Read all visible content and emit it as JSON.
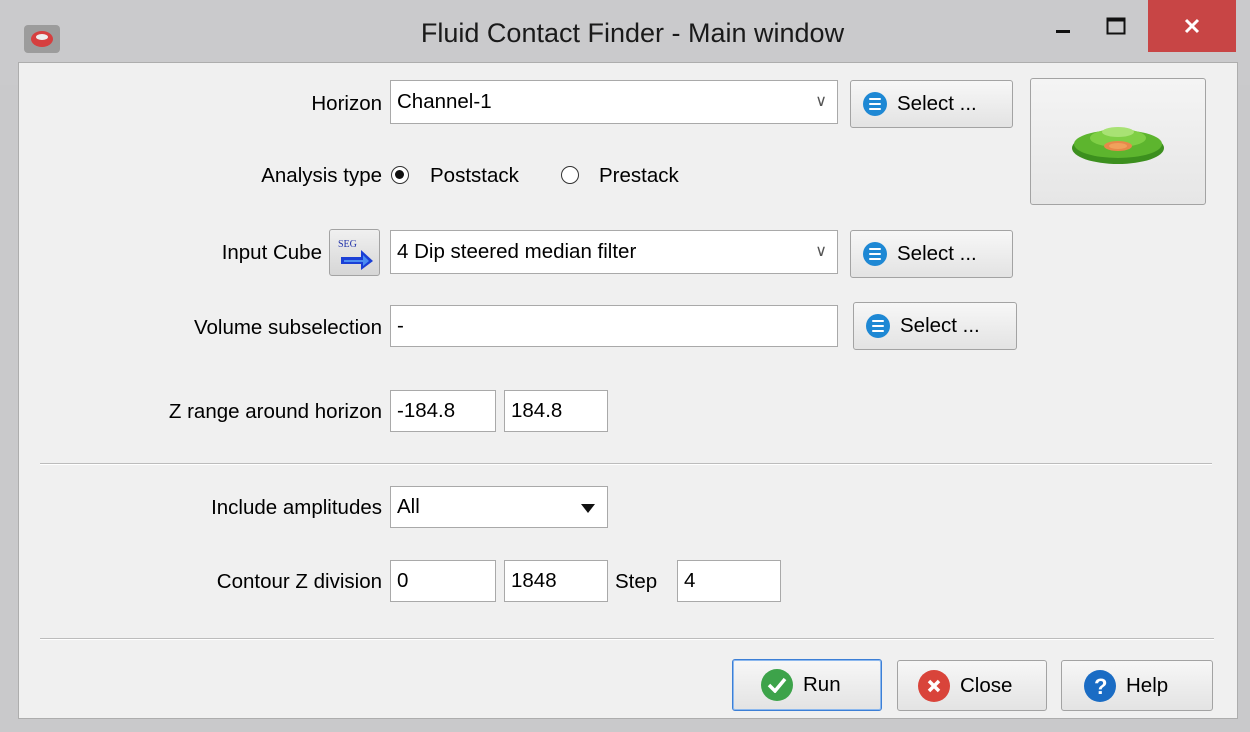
{
  "window": {
    "title": "Fluid Contact Finder - Main window"
  },
  "horizon": {
    "label": "Horizon",
    "value": "Channel-1",
    "select_label": "Select ..."
  },
  "analysis": {
    "label": "Analysis type",
    "options": [
      "Poststack",
      "Prestack"
    ],
    "selected": "Poststack"
  },
  "input_cube": {
    "label": "Input Cube",
    "value": "4 Dip steered median filter",
    "select_label": "Select ...",
    "icon_text": "SEG"
  },
  "volume": {
    "label": "Volume subselection",
    "value": "-",
    "select_label": "Select ..."
  },
  "zrange": {
    "label": "Z range around horizon",
    "start": "-184.8",
    "stop": "184.8"
  },
  "amplitudes": {
    "label": "Include amplitudes",
    "value": "All"
  },
  "contour": {
    "label": "Contour Z division",
    "start": "0",
    "stop": "1848",
    "step_label": "Step",
    "step": "4"
  },
  "buttons": {
    "run": "Run",
    "close": "Close",
    "help": "Help"
  },
  "colors": {
    "accent": "#1e88d4",
    "run": "#3da34a",
    "close": "#d9443a",
    "help": "#1a6cc4",
    "close_window": "#c84545"
  }
}
